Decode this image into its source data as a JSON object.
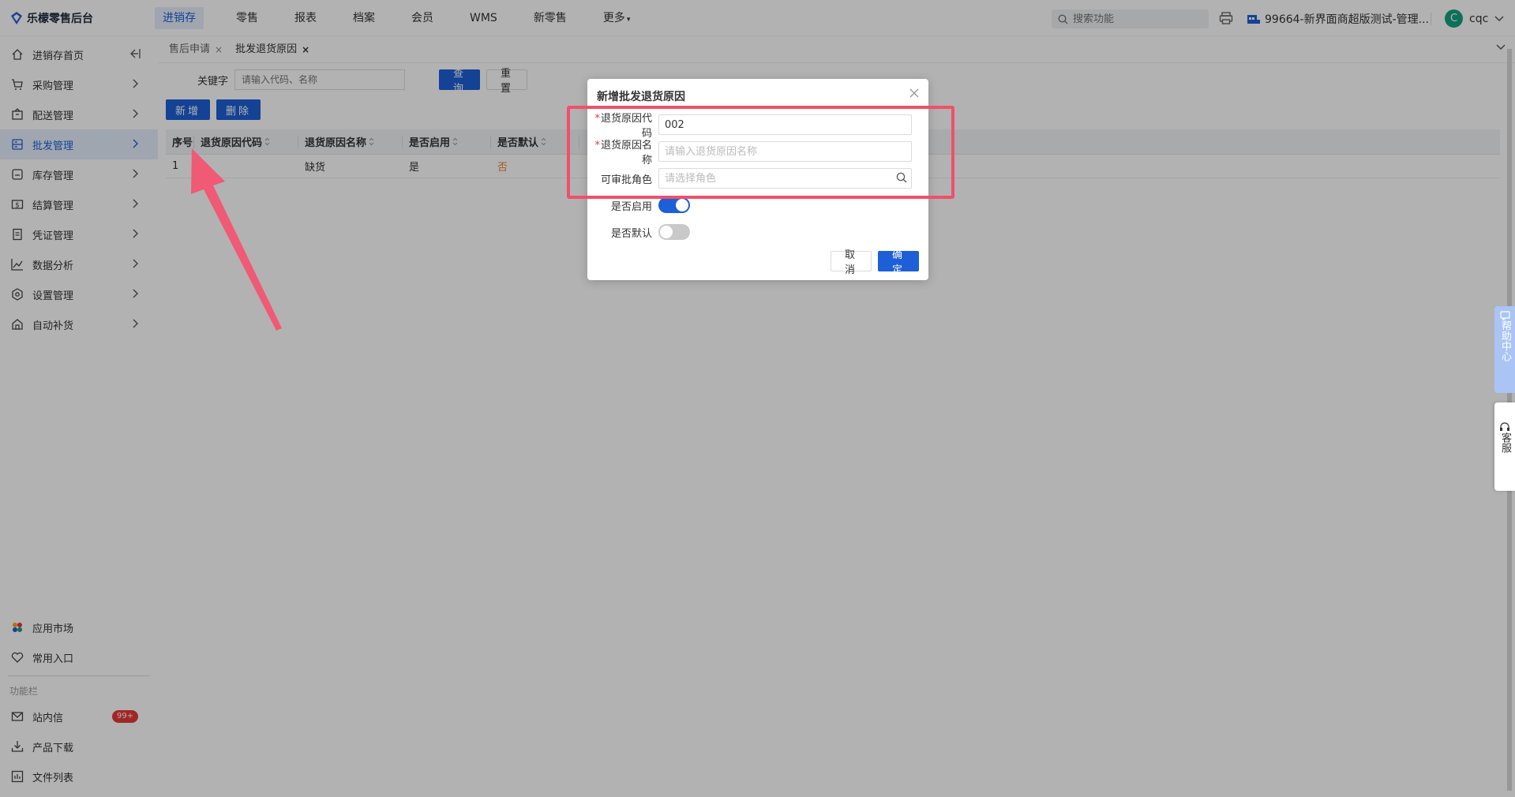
{
  "app": {
    "title": "乐檬零售后台"
  },
  "nav": {
    "items": [
      "进销存",
      "零售",
      "报表",
      "档案",
      "会员",
      "WMS",
      "新零售",
      "更多"
    ],
    "active": "进销存"
  },
  "header": {
    "search_placeholder": "搜索功能",
    "store_name": "99664-新界面商超版测试-管理...",
    "user_initial": "C",
    "user_name": "cqc"
  },
  "sidebar": {
    "items": [
      {
        "label": "进销存首页",
        "icon": "home-icon"
      },
      {
        "label": "采购管理",
        "icon": "cart-icon"
      },
      {
        "label": "配送管理",
        "icon": "box-icon"
      },
      {
        "label": "批发管理",
        "icon": "server-icon"
      },
      {
        "label": "库存管理",
        "icon": "inventory-icon"
      },
      {
        "label": "结算管理",
        "icon": "money-icon"
      },
      {
        "label": "凭证管理",
        "icon": "doc-icon"
      },
      {
        "label": "数据分析",
        "icon": "chart-icon"
      },
      {
        "label": "设置管理",
        "icon": "settings-icon"
      },
      {
        "label": "自动补货",
        "icon": "replenish-icon"
      }
    ],
    "active_index": 3,
    "bottom": {
      "app_market": "应用市场",
      "common_entry": "常用入口",
      "section_caption": "功能栏",
      "messages": "站内信",
      "messages_badge": "99+",
      "product_download": "产品下载",
      "file_list": "文件列表"
    }
  },
  "tabs": [
    {
      "label": "售后申请",
      "active": false
    },
    {
      "label": "批发退货原因",
      "active": true
    }
  ],
  "filter": {
    "keyword_label": "关键字",
    "keyword_placeholder": "请输入代码、名称",
    "query_button": "查询",
    "reset_button": "重置"
  },
  "actions": {
    "add_button": "新增",
    "delete_button": "删除"
  },
  "table": {
    "columns": [
      "序号",
      "退货原因代码",
      "退货原因名称",
      "是否启用",
      "是否默认"
    ],
    "rows": [
      {
        "index": "1",
        "code": "",
        "name": "缺货",
        "enabled": "是",
        "default": "否"
      }
    ]
  },
  "dialog": {
    "title": "新增批发退货原因",
    "fields": {
      "code_label": "退货原因代码",
      "code_value": "002",
      "name_label": "退货原因名称",
      "name_placeholder": "请输入退货原因名称",
      "role_label": "可审批角色",
      "role_placeholder": "请选择角色",
      "enabled_label": "是否启用",
      "enabled_value": true,
      "default_label": "是否默认",
      "default_value": false
    },
    "cancel_button": "取消",
    "ok_button": "确定"
  },
  "right_widgets": {
    "help": "帮助中心",
    "service": "客服"
  },
  "colors": {
    "primary": "#1d5fd6",
    "highlight": "#f0506a",
    "badge": "#e53935",
    "default_no": "#e8862c"
  }
}
